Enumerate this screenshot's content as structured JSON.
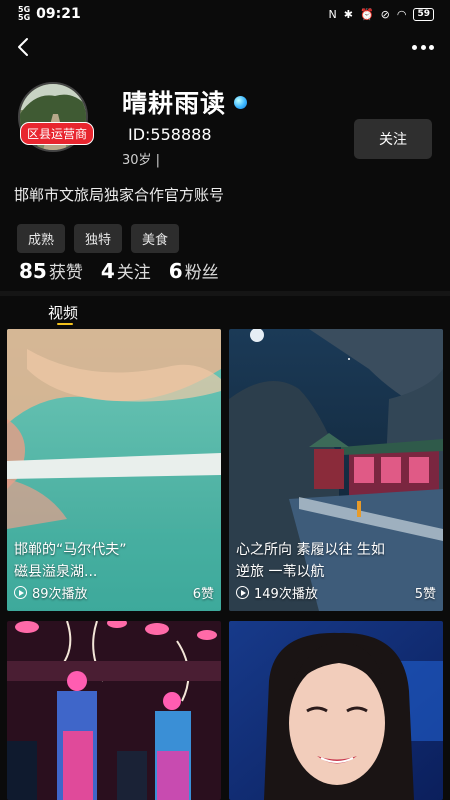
{
  "status_bar": {
    "signal_a": "5G",
    "signal_b": "5G",
    "time": "09:21",
    "battery": "59"
  },
  "icons": {
    "back": "chevron-left-icon",
    "more": "more-dots-icon",
    "verified": "verified-badge-icon",
    "play": "play-circle-icon"
  },
  "profile": {
    "role_badge": "区县运营商",
    "name": "晴耕雨读",
    "user_id": "ID:558888",
    "age": "30岁 |",
    "follow_label": "关注",
    "bio": "邯郸市文旅局独家合作官方账号",
    "tags": [
      "成熟",
      "独特",
      "美食"
    ],
    "stats": {
      "likes_num": "85",
      "likes_label": "获赞",
      "following_num": "4",
      "following_label": "关注",
      "fans_num": "6",
      "fans_label": "粉丝"
    }
  },
  "tabs": {
    "videos": "视频"
  },
  "videos": [
    {
      "title_line1": "邯郸的“马尔代夫”",
      "title_line2": "磁县溢泉湖...",
      "plays": "89次播放",
      "likes": "6赞"
    },
    {
      "title_line1": "心之所向  素履以往    生如",
      "title_line2": "逆旅   一苇以航",
      "plays": "149次播放",
      "likes": "5赞"
    },
    {
      "title_line1": "",
      "title_line2": "",
      "plays": "",
      "likes": ""
    },
    {
      "title_line1": "",
      "title_line2": "",
      "plays": "",
      "likes": ""
    }
  ],
  "colors": {
    "background": "#0b0b0b",
    "badge_red": "#e8262f",
    "tab_underline": "#f3c21d",
    "verified_blue": "#3bb6ff"
  }
}
